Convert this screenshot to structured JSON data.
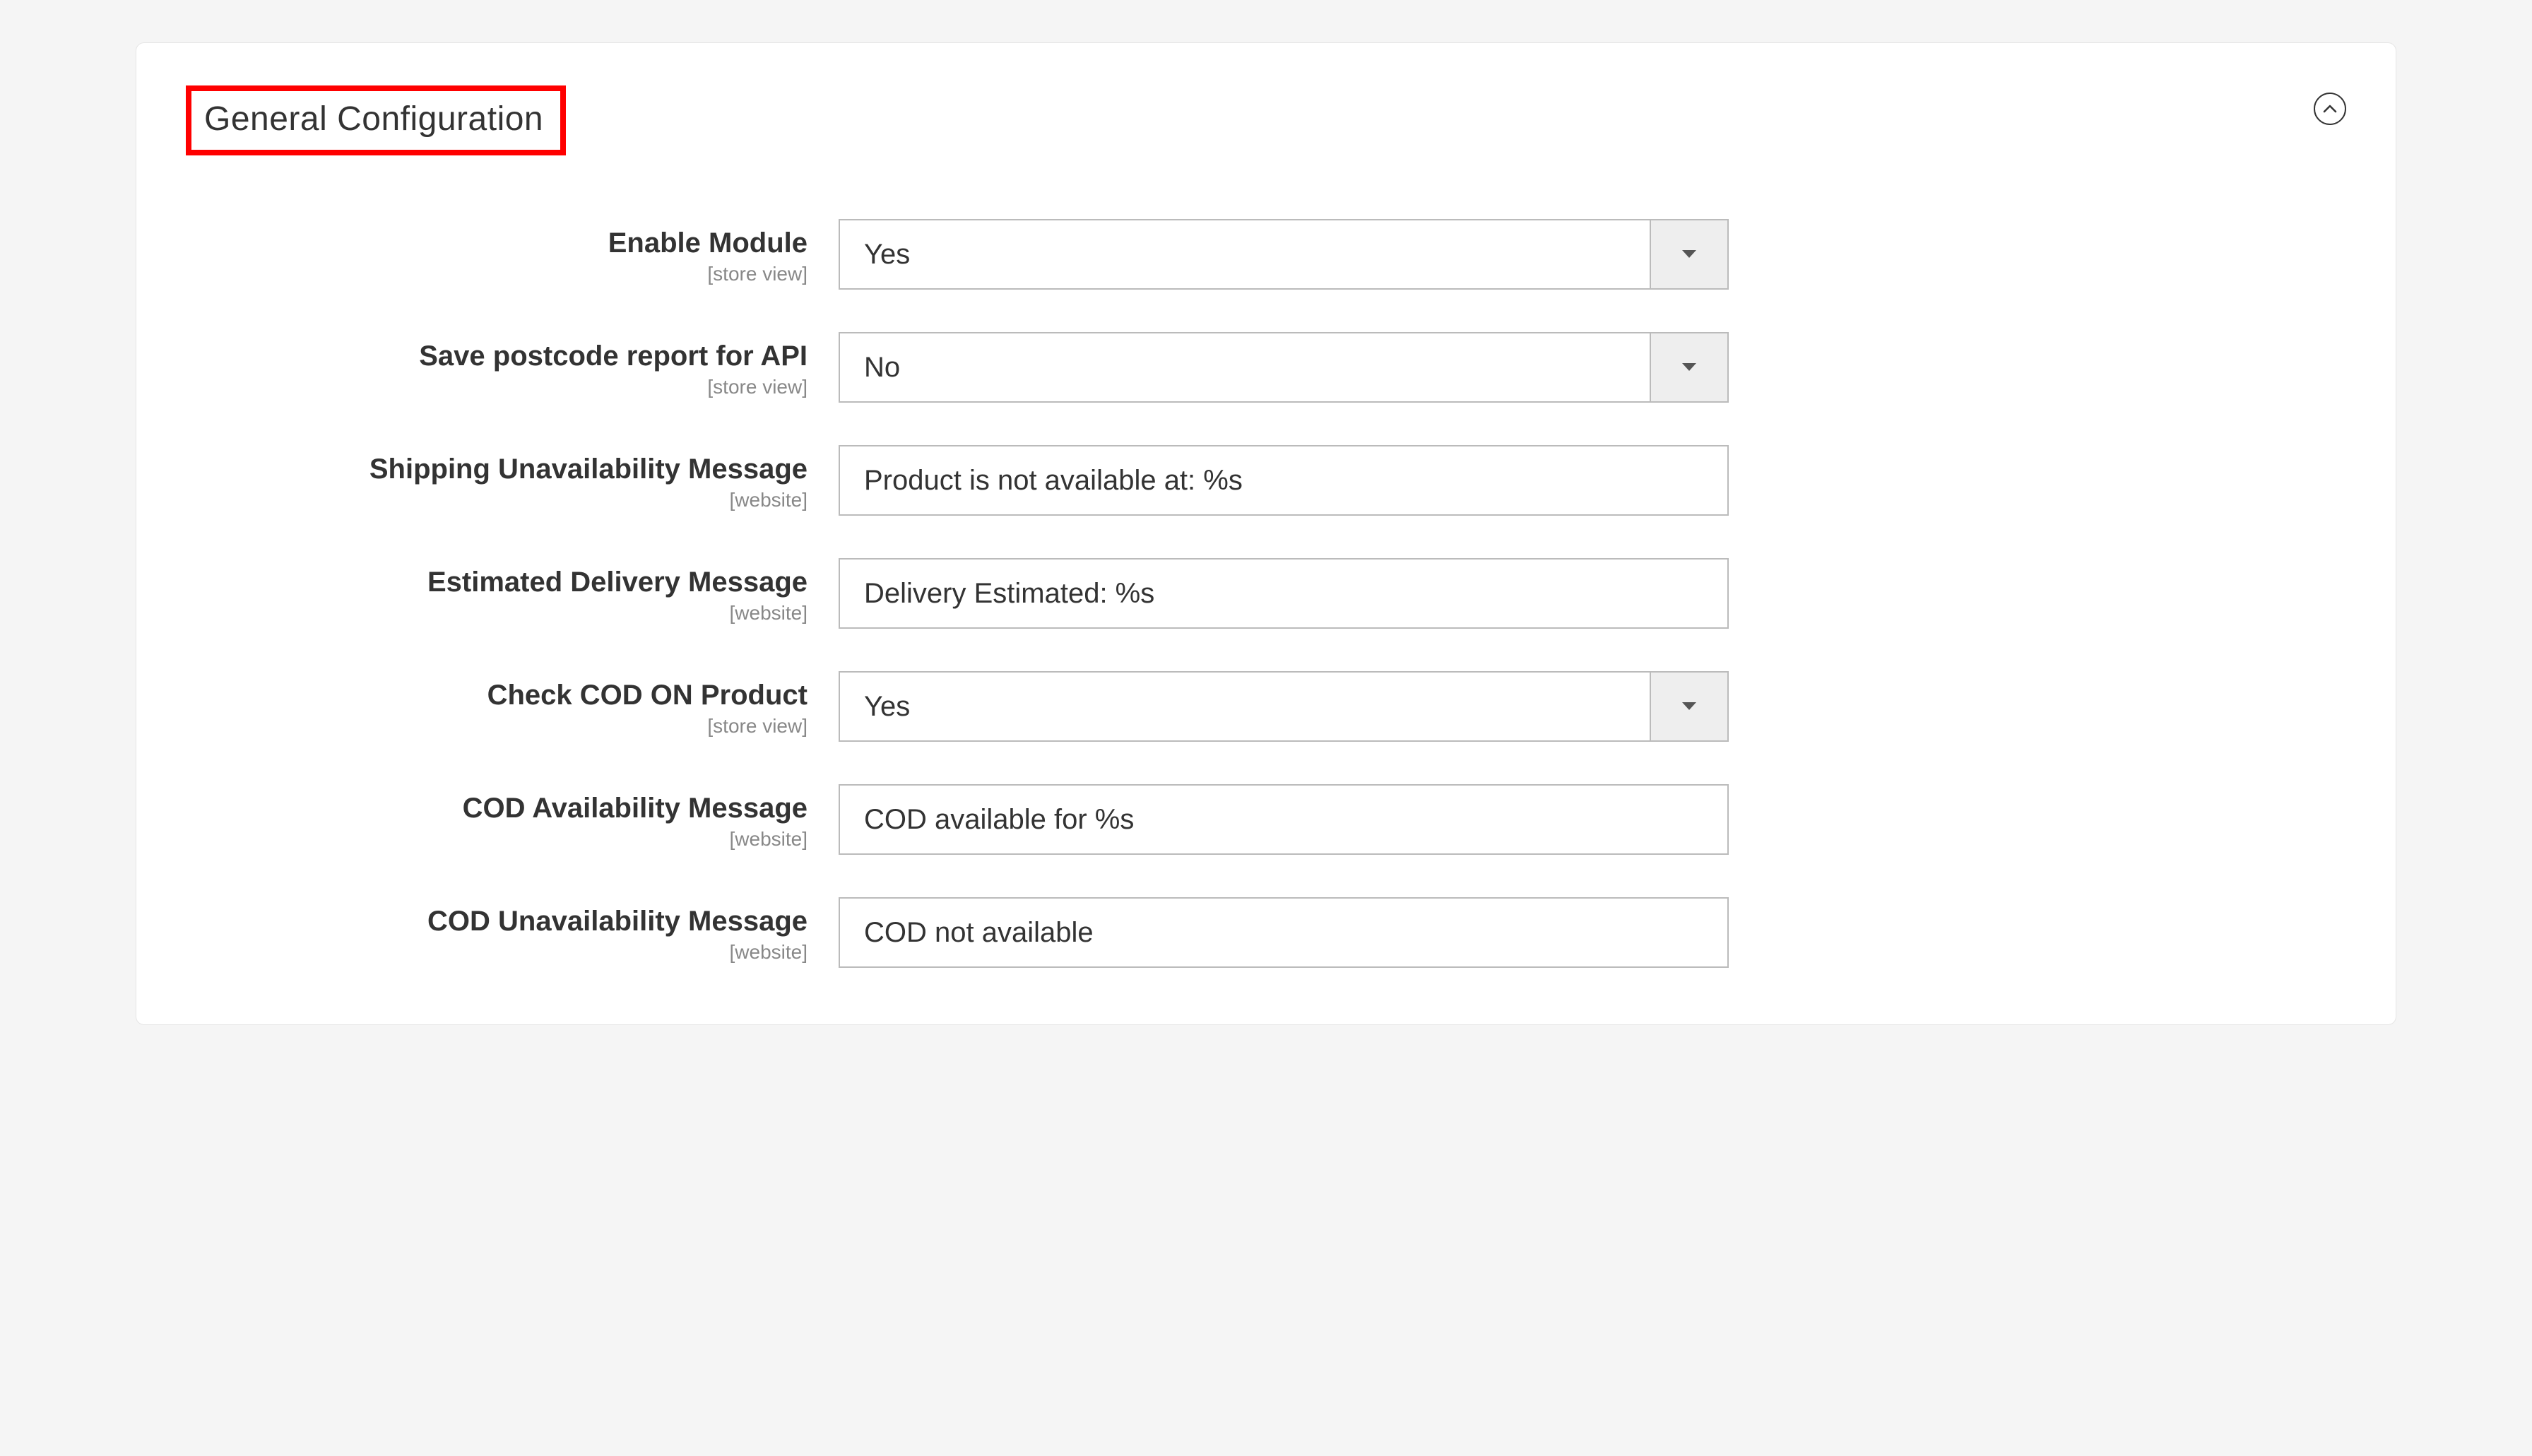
{
  "section": {
    "title": "General Configuration"
  },
  "scopes": {
    "store_view": "[store view]",
    "website": "[website]"
  },
  "fields": {
    "enable_module": {
      "label": "Enable Module",
      "value": "Yes"
    },
    "save_postcode_report": {
      "label": "Save postcode report for API",
      "value": "No"
    },
    "shipping_unavail_msg": {
      "label": "Shipping Unavailability Message",
      "value": "Product is not available at: %s"
    },
    "est_delivery_msg": {
      "label": "Estimated Delivery Message",
      "value": "Delivery Estimated: %s"
    },
    "check_cod": {
      "label": "Check COD ON Product",
      "value": "Yes"
    },
    "cod_avail_msg": {
      "label": "COD Availability Message",
      "value": "COD available for %s"
    },
    "cod_unavail_msg": {
      "label": "COD Unavailability Message",
      "value": "COD not available"
    }
  }
}
